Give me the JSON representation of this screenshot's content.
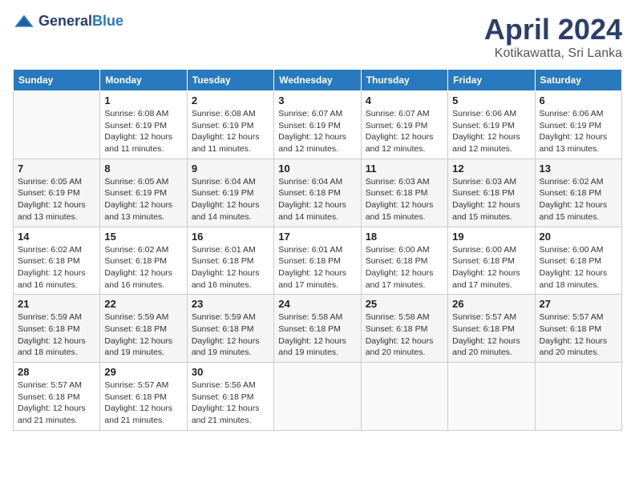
{
  "header": {
    "logo_general": "General",
    "logo_blue": "Blue",
    "month_year": "April 2024",
    "location": "Kotikawatta, Sri Lanka"
  },
  "weekdays": [
    "Sunday",
    "Monday",
    "Tuesday",
    "Wednesday",
    "Thursday",
    "Friday",
    "Saturday"
  ],
  "weeks": [
    [
      {
        "day": "",
        "info": ""
      },
      {
        "day": "1",
        "info": "Sunrise: 6:08 AM\nSunset: 6:19 PM\nDaylight: 12 hours\nand 11 minutes."
      },
      {
        "day": "2",
        "info": "Sunrise: 6:08 AM\nSunset: 6:19 PM\nDaylight: 12 hours\nand 11 minutes."
      },
      {
        "day": "3",
        "info": "Sunrise: 6:07 AM\nSunset: 6:19 PM\nDaylight: 12 hours\nand 12 minutes."
      },
      {
        "day": "4",
        "info": "Sunrise: 6:07 AM\nSunset: 6:19 PM\nDaylight: 12 hours\nand 12 minutes."
      },
      {
        "day": "5",
        "info": "Sunrise: 6:06 AM\nSunset: 6:19 PM\nDaylight: 12 hours\nand 12 minutes."
      },
      {
        "day": "6",
        "info": "Sunrise: 6:06 AM\nSunset: 6:19 PM\nDaylight: 12 hours\nand 13 minutes."
      }
    ],
    [
      {
        "day": "7",
        "info": "Sunrise: 6:05 AM\nSunset: 6:19 PM\nDaylight: 12 hours\nand 13 minutes."
      },
      {
        "day": "8",
        "info": "Sunrise: 6:05 AM\nSunset: 6:19 PM\nDaylight: 12 hours\nand 13 minutes."
      },
      {
        "day": "9",
        "info": "Sunrise: 6:04 AM\nSunset: 6:19 PM\nDaylight: 12 hours\nand 14 minutes."
      },
      {
        "day": "10",
        "info": "Sunrise: 6:04 AM\nSunset: 6:18 PM\nDaylight: 12 hours\nand 14 minutes."
      },
      {
        "day": "11",
        "info": "Sunrise: 6:03 AM\nSunset: 6:18 PM\nDaylight: 12 hours\nand 15 minutes."
      },
      {
        "day": "12",
        "info": "Sunrise: 6:03 AM\nSunset: 6:18 PM\nDaylight: 12 hours\nand 15 minutes."
      },
      {
        "day": "13",
        "info": "Sunrise: 6:02 AM\nSunset: 6:18 PM\nDaylight: 12 hours\nand 15 minutes."
      }
    ],
    [
      {
        "day": "14",
        "info": "Sunrise: 6:02 AM\nSunset: 6:18 PM\nDaylight: 12 hours\nand 16 minutes."
      },
      {
        "day": "15",
        "info": "Sunrise: 6:02 AM\nSunset: 6:18 PM\nDaylight: 12 hours\nand 16 minutes."
      },
      {
        "day": "16",
        "info": "Sunrise: 6:01 AM\nSunset: 6:18 PM\nDaylight: 12 hours\nand 16 minutes."
      },
      {
        "day": "17",
        "info": "Sunrise: 6:01 AM\nSunset: 6:18 PM\nDaylight: 12 hours\nand 17 minutes."
      },
      {
        "day": "18",
        "info": "Sunrise: 6:00 AM\nSunset: 6:18 PM\nDaylight: 12 hours\nand 17 minutes."
      },
      {
        "day": "19",
        "info": "Sunrise: 6:00 AM\nSunset: 6:18 PM\nDaylight: 12 hours\nand 17 minutes."
      },
      {
        "day": "20",
        "info": "Sunrise: 6:00 AM\nSunset: 6:18 PM\nDaylight: 12 hours\nand 18 minutes."
      }
    ],
    [
      {
        "day": "21",
        "info": "Sunrise: 5:59 AM\nSunset: 6:18 PM\nDaylight: 12 hours\nand 18 minutes."
      },
      {
        "day": "22",
        "info": "Sunrise: 5:59 AM\nSunset: 6:18 PM\nDaylight: 12 hours\nand 19 minutes."
      },
      {
        "day": "23",
        "info": "Sunrise: 5:59 AM\nSunset: 6:18 PM\nDaylight: 12 hours\nand 19 minutes."
      },
      {
        "day": "24",
        "info": "Sunrise: 5:58 AM\nSunset: 6:18 PM\nDaylight: 12 hours\nand 19 minutes."
      },
      {
        "day": "25",
        "info": "Sunrise: 5:58 AM\nSunset: 6:18 PM\nDaylight: 12 hours\nand 20 minutes."
      },
      {
        "day": "26",
        "info": "Sunrise: 5:57 AM\nSunset: 6:18 PM\nDaylight: 12 hours\nand 20 minutes."
      },
      {
        "day": "27",
        "info": "Sunrise: 5:57 AM\nSunset: 6:18 PM\nDaylight: 12 hours\nand 20 minutes."
      }
    ],
    [
      {
        "day": "28",
        "info": "Sunrise: 5:57 AM\nSunset: 6:18 PM\nDaylight: 12 hours\nand 21 minutes."
      },
      {
        "day": "29",
        "info": "Sunrise: 5:57 AM\nSunset: 6:18 PM\nDaylight: 12 hours\nand 21 minutes."
      },
      {
        "day": "30",
        "info": "Sunrise: 5:56 AM\nSunset: 6:18 PM\nDaylight: 12 hours\nand 21 minutes."
      },
      {
        "day": "",
        "info": ""
      },
      {
        "day": "",
        "info": ""
      },
      {
        "day": "",
        "info": ""
      },
      {
        "day": "",
        "info": ""
      }
    ]
  ]
}
